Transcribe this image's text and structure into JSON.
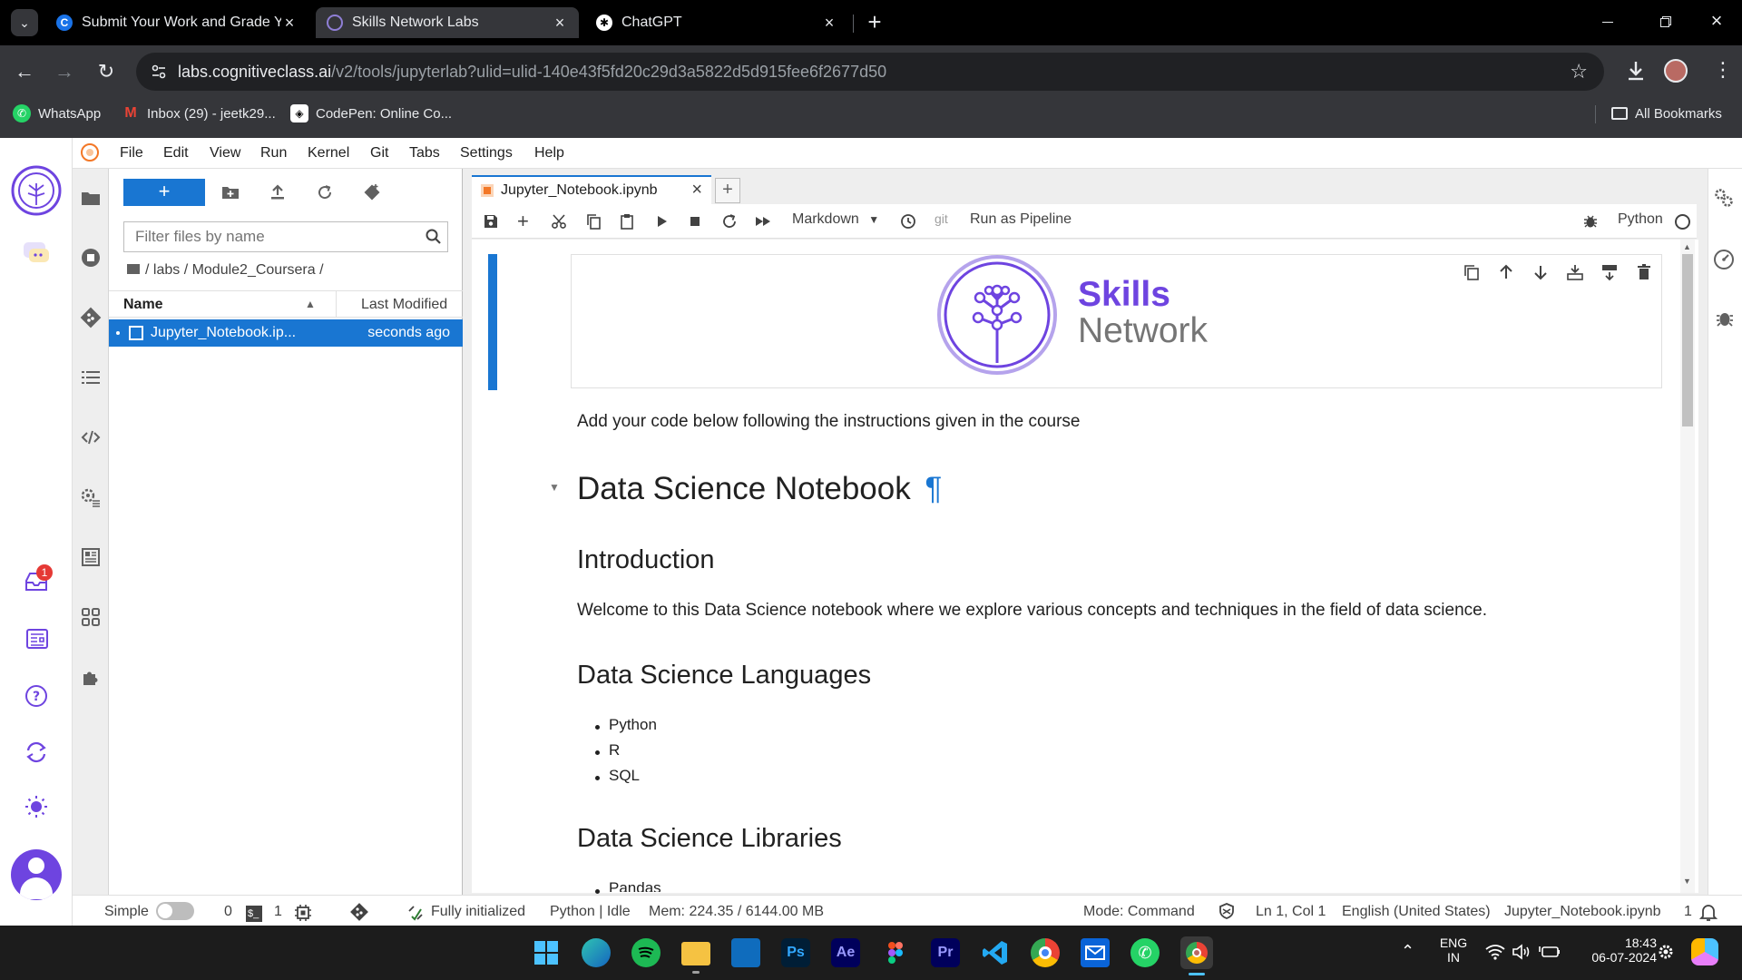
{
  "browser": {
    "tabs": [
      {
        "title": "Submit Your Work and Grade Yo",
        "active": false
      },
      {
        "title": "Skills Network Labs",
        "active": true
      },
      {
        "title": "ChatGPT",
        "active": false
      }
    ],
    "address": {
      "host": "labs.cognitiveclass.ai",
      "path": "/v2/tools/jupyterlab?ulid=ulid-140e43f5fd20c29d3a5822d5d915fee6f2677d50"
    },
    "bookmarks": [
      "WhatsApp",
      "Inbox (29) - jeetk29...",
      "CodePen: Online Co..."
    ],
    "all_bookmarks": "All Bookmarks"
  },
  "jupyter": {
    "menus": [
      "File",
      "Edit",
      "View",
      "Run",
      "Kernel",
      "Git",
      "Tabs",
      "Settings",
      "Help"
    ],
    "notification_count": "1",
    "filebrowser": {
      "new_label": "+",
      "filter_placeholder": "Filter files by name",
      "breadcrumb": "/ labs / Module2_Coursera /",
      "col_name": "Name",
      "col_modified": "Last Modified",
      "file": {
        "name": "Jupyter_Notebook.ip...",
        "modified": "seconds ago"
      }
    },
    "notebook": {
      "tab_title": "Jupyter_Notebook.ipynb",
      "cell_type": "Markdown",
      "git_label": "git",
      "pipeline_label": "Run as Pipeline",
      "kernel": "Python",
      "logo": {
        "word1": "Skills",
        "word2": "Network"
      },
      "instructions": "Add your code below following the instructions given in the course",
      "title": "Data Science Notebook",
      "anchor": "¶",
      "intro_heading": "Introduction",
      "intro_text": "Welcome to this Data Science notebook where we explore various concepts and techniques in the field of data science.",
      "languages_heading": "Data Science Languages",
      "languages": [
        "Python",
        "R",
        "SQL"
      ],
      "libraries_heading": "Data Science Libraries",
      "libraries": [
        "Pandas"
      ]
    },
    "status": {
      "mode_label": "Simple",
      "terminals": "0",
      "kernels": "1",
      "init": "Fully initialized",
      "kernel_state": "Python | Idle",
      "memory": "Mem: 224.35 / 6144.00 MB",
      "mode": "Mode: Command",
      "cursor": "Ln 1, Col 1",
      "language": "English (United States)",
      "file": "Jupyter_Notebook.ipynb",
      "count": "1"
    }
  },
  "taskbar": {
    "apps": [
      "Windows",
      "Edge",
      "Spotify",
      "File Explorer",
      "Store",
      "Photoshop",
      "After Effects",
      "Figma",
      "Premiere Pro",
      "VS Code",
      "Chrome",
      "Mail",
      "WhatsApp",
      "Chrome Profile"
    ],
    "lang_top": "ENG",
    "lang_bottom": "IN",
    "time": "18:43",
    "date": "06-07-2024"
  },
  "colors": {
    "accent": "#1976d2",
    "brand_purple": "#6e44e0",
    "brand_gray": "#757575",
    "chrome_dark": "#35363a"
  }
}
